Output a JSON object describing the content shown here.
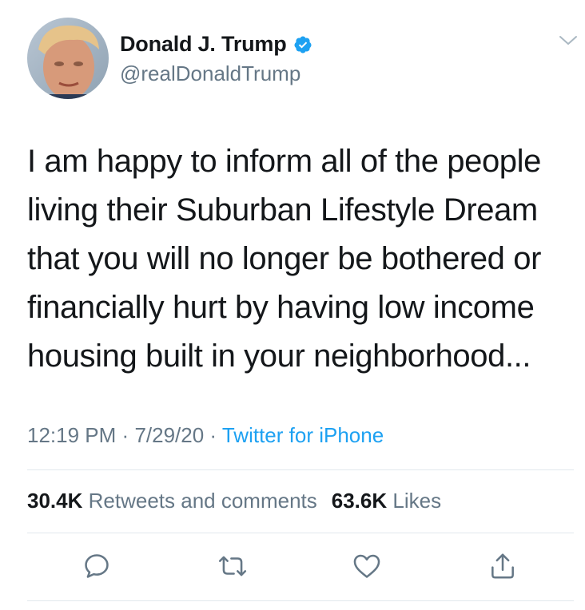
{
  "author": {
    "display_name": "Donald J. Trump",
    "handle": "@realDonaldTrump",
    "verified": true
  },
  "tweet": {
    "text": "I am happy to inform all of the people living their Suburban Lifestyle Dream that you will no longer be bothered or financially hurt by having low income housing built in your neighborhood...",
    "time": "12:19 PM",
    "separator": "·",
    "date": "7/29/20",
    "source": "Twitter for iPhone"
  },
  "stats": {
    "retweets_count": "30.4K",
    "retweets_label": "Retweets and comments",
    "likes_count": "63.6K",
    "likes_label": "Likes"
  },
  "icons": {
    "verified": "verified-badge-icon",
    "more": "chevron-down-icon",
    "reply": "reply-icon",
    "retweet": "retweet-icon",
    "like": "heart-icon",
    "share": "share-icon"
  },
  "colors": {
    "text": "#14171a",
    "secondary": "#657786",
    "accent": "#1da1f2",
    "divider": "#e1e8ed"
  }
}
